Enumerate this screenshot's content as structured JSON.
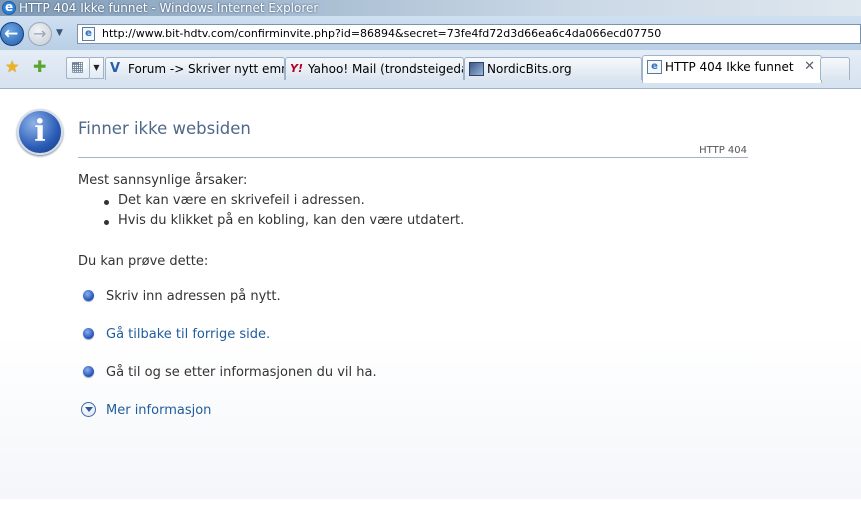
{
  "window": {
    "title": "HTTP 404 Ikke funnet - Windows Internet Explorer"
  },
  "address": {
    "url": "http://www.bit-hdtv.com/confirminvite.php?id=86894&secret=73fe4fd72d3d66ea6c4da066ecd07750"
  },
  "tabs": [
    {
      "label": "Forum -> Skriver nytt emn...",
      "icon": "forum-favicon"
    },
    {
      "label": "Yahoo! Mail (trondsteigedal)",
      "icon": "yahoo-favicon"
    },
    {
      "label": "NordicBits.org",
      "icon": "nordicbits-favicon"
    },
    {
      "label": "HTTP 404 Ikke funnet",
      "icon": "ie-page-icon",
      "active": true,
      "close": "✕"
    }
  ],
  "page": {
    "heading": "Finner ikke websiden",
    "http_code": "HTTP 404",
    "causes_title": "Mest sannsynlige årsaker:",
    "causes": [
      "Det kan være en skrivefeil i adressen.",
      "Hvis du klikket på en kobling, kan den være utdatert."
    ],
    "try_title": "Du kan prøve dette:",
    "suggestions": [
      {
        "text": "Skriv inn adressen på nytt."
      },
      {
        "text": "Gå tilbake til forrige side."
      },
      {
        "text": "Gå til  og se etter informasjonen du vil ha."
      }
    ],
    "more_info": "Mer informasjon"
  },
  "colors": {
    "heading": "#4e6989",
    "link": "#1f5c9d",
    "titlebar": "#7f9ab5"
  }
}
